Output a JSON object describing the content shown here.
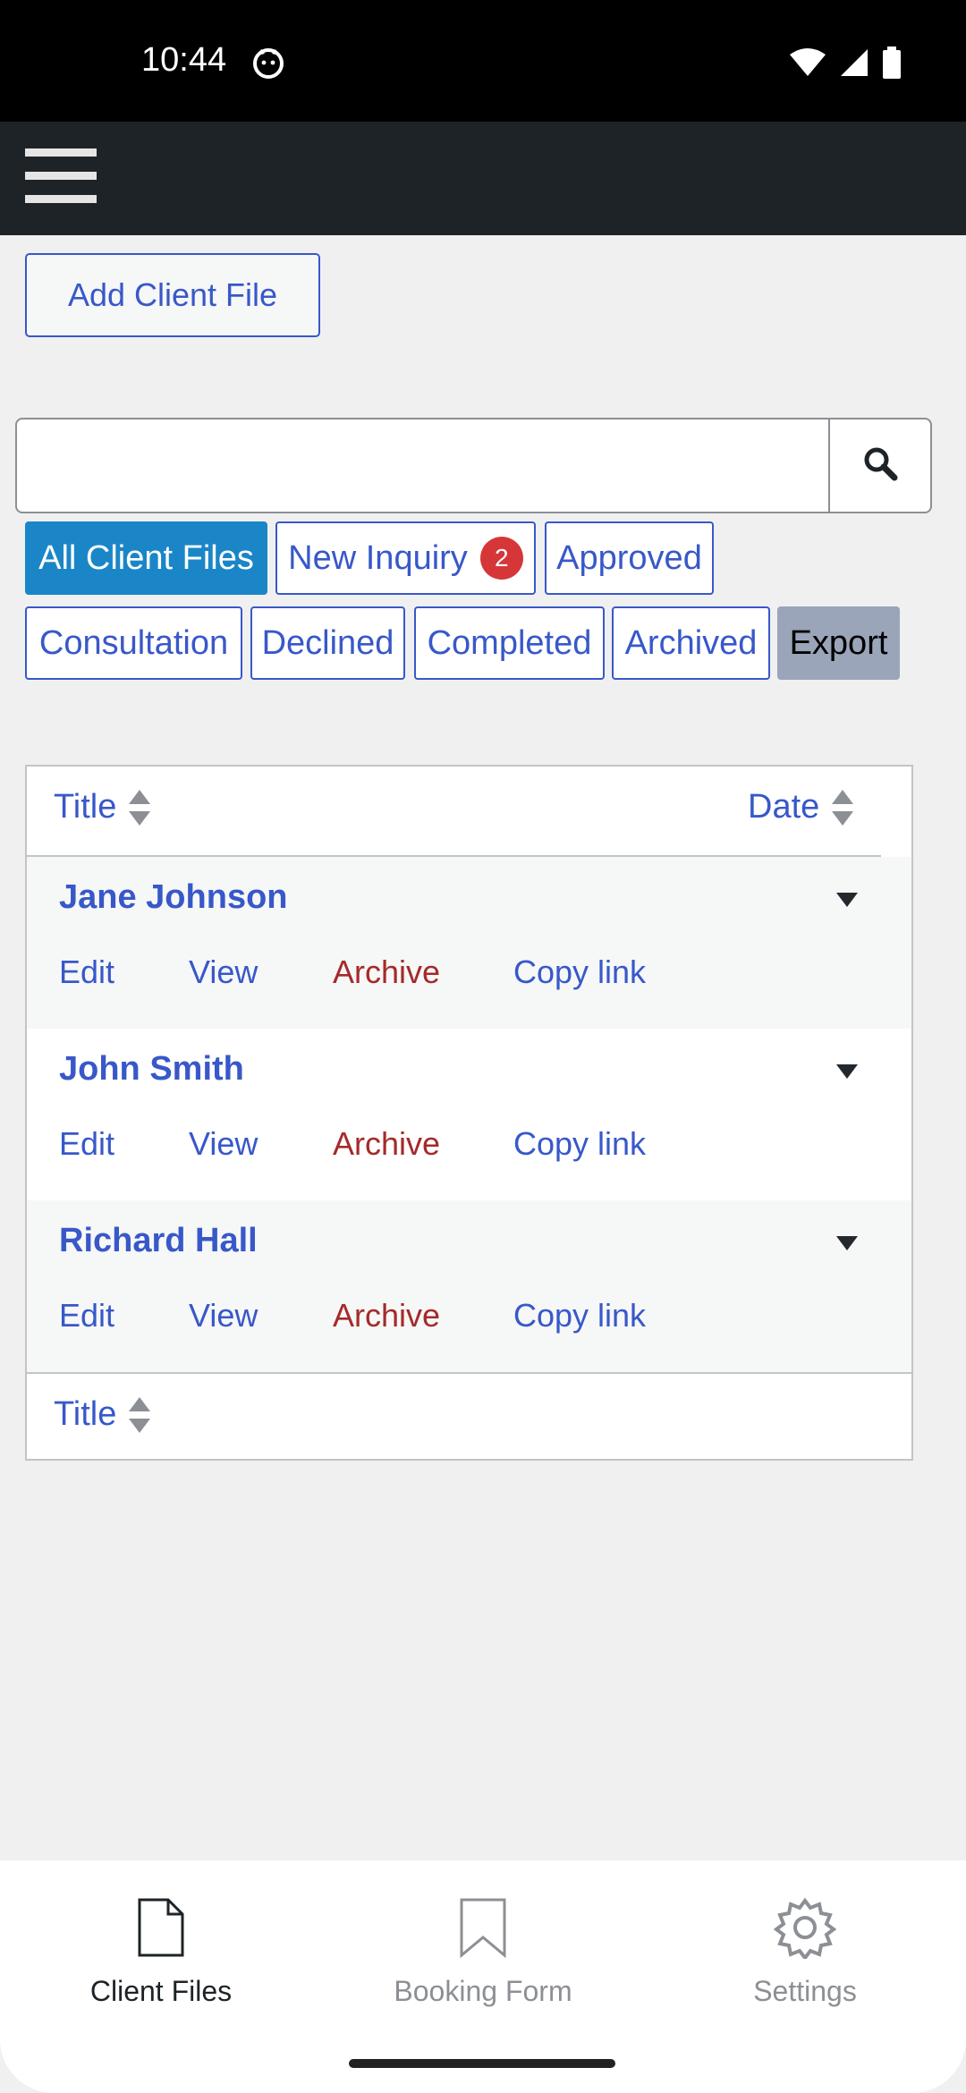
{
  "status": {
    "time": "10:44"
  },
  "toolbar": {
    "add_label": "Add Client File"
  },
  "search": {
    "placeholder": ""
  },
  "filters": [
    {
      "label": "All Client Files"
    },
    {
      "label": "New Inquiry",
      "badge": "2"
    },
    {
      "label": "Approved"
    },
    {
      "label": "Consultation"
    },
    {
      "label": "Declined"
    },
    {
      "label": "Completed"
    },
    {
      "label": "Archived"
    },
    {
      "label": "Export"
    }
  ],
  "table": {
    "header": {
      "title": "Title",
      "date": "Date"
    },
    "footer": {
      "title": "Title"
    },
    "rows": [
      {
        "title": "Jane Johnson",
        "actions": {
          "edit": "Edit",
          "view": "View",
          "archive": "Archive",
          "copy": "Copy link"
        }
      },
      {
        "title": "John Smith",
        "actions": {
          "edit": "Edit",
          "view": "View",
          "archive": "Archive",
          "copy": "Copy link"
        }
      },
      {
        "title": "Richard Hall",
        "actions": {
          "edit": "Edit",
          "view": "View",
          "archive": "Archive",
          "copy": "Copy link"
        }
      }
    ]
  },
  "bottom_nav": [
    {
      "label": "Client Files",
      "icon": "file-icon",
      "active": true
    },
    {
      "label": "Booking Form",
      "icon": "bookmark-icon",
      "active": false
    },
    {
      "label": "Settings",
      "icon": "gear-icon",
      "active": false
    }
  ],
  "colors": {
    "accent": "#3858c9",
    "active_filter": "#1a86c8",
    "archive": "#a52a2a",
    "badge": "#d63638",
    "topbar": "#1e2327"
  }
}
